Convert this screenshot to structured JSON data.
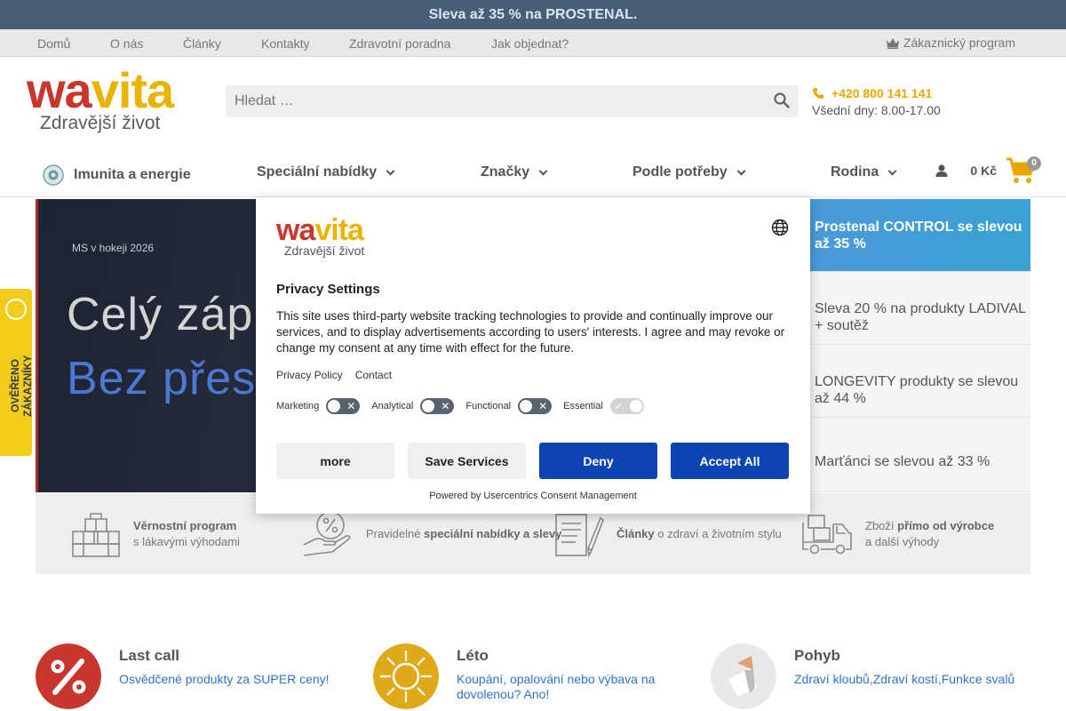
{
  "promo": {
    "text": "Sleva až 35 % na PROSTENAL."
  },
  "topnav": {
    "items": [
      "Domů",
      "O nás",
      "Články",
      "Kontakty",
      "Zdravotní poradna",
      "Jak objednat?"
    ],
    "loyalty_label": "Zákaznický program"
  },
  "logo": {
    "word_a": "wa",
    "word_b": "vita",
    "tagline": "Zdravější život"
  },
  "search": {
    "placeholder": "Hledat …"
  },
  "contact": {
    "phone": "+420 800 141 141",
    "hours": "Všední dny: 8.00-17.00"
  },
  "mainnav": {
    "items": [
      "Imunita a energie",
      "Speciální nabídky",
      "Značky",
      "Podle potřeby",
      "Rodina"
    ]
  },
  "cart": {
    "total": "0 Kč",
    "count": "0"
  },
  "hero": {
    "tag": "MS v hokeji 2026",
    "line1": "Celý záp",
    "line2": "Bez přes"
  },
  "side_promos": [
    "Prostenal CONTROL se slevou až 35 %",
    "Sleva 20 % na produkty LADIVAL + soutěž",
    "LONGEVITY produkty se slevou až 44 %",
    "Marťánci se slevou až 33 %"
  ],
  "features": [
    {
      "bold": "Věrnostní program",
      "rest": "s lákavými výhodami"
    },
    {
      "pre": "Pravidelné ",
      "bold": "speciální nabídky a slevy"
    },
    {
      "bold": "Články",
      "rest": " o zdraví a životním stylu"
    },
    {
      "pre": "Zboží ",
      "bold": "přímo od výrobce",
      "rest": "a další výhody"
    }
  ],
  "cookie": {
    "logo_a": "wa",
    "logo_b": "vita",
    "logo_sub": "Zdravější život",
    "title": "Privacy Settings",
    "text": "This site uses third-party website tracking technologies to provide and continually improve our services, and to display advertisements according to users' interests. I agree and may revoke or change my consent at any time with effect for the future.",
    "links": [
      "Privacy Policy",
      "Contact"
    ],
    "toggles": [
      "Marketing",
      "Analytical",
      "Functional",
      "Essential"
    ],
    "buttons": {
      "more": "more",
      "save": "Save Services",
      "deny": "Deny",
      "accept": "Accept All"
    },
    "powered": "Powered by Usercentrics Consent Management"
  },
  "verified_badge": {
    "text": "OVĚŘENO ZÁKAZNÍKY"
  },
  "categories": [
    {
      "title": "Last call",
      "sub": "Osvědčené produkty za SUPER ceny!"
    },
    {
      "title": "Léto",
      "sub": "Koupání, opalování nebo výbava na dovolenou? Ano!"
    },
    {
      "title": "Pohyb",
      "sub": "Zdraví kloubů,Zdraví kostí,Funkce svalů"
    }
  ],
  "colors": {
    "accent_yellow": "#e9b400",
    "brand_red": "#c8362c",
    "consent_blue": "#0c45b2",
    "promo_blue": "#4a99d8"
  }
}
